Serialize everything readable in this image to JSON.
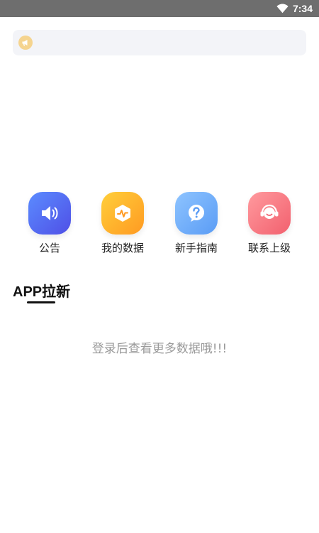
{
  "status_bar": {
    "time": "7:34",
    "wifi_icon": "wifi-icon"
  },
  "notice": {
    "icon": "megaphone-icon",
    "text": "",
    "icon_color": "#f5d48f"
  },
  "menu": [
    {
      "label": "公告",
      "icon": "speaker-icon",
      "colors": [
        "#5b8cff",
        "#4f4fe6"
      ]
    },
    {
      "label": "我的数据",
      "icon": "data-chart-icon",
      "colors": [
        "#ffcf3a",
        "#ff9a22"
      ]
    },
    {
      "label": "新手指南",
      "icon": "help-icon",
      "colors": [
        "#8ec4ff",
        "#5a9cf5"
      ]
    },
    {
      "label": "联系上级",
      "icon": "customer-service-icon",
      "colors": [
        "#ff9a9e",
        "#f2606e"
      ]
    }
  ],
  "section": {
    "title": "APP拉新"
  },
  "empty_state": {
    "text": "登录后查看更多数据哦!!!"
  }
}
